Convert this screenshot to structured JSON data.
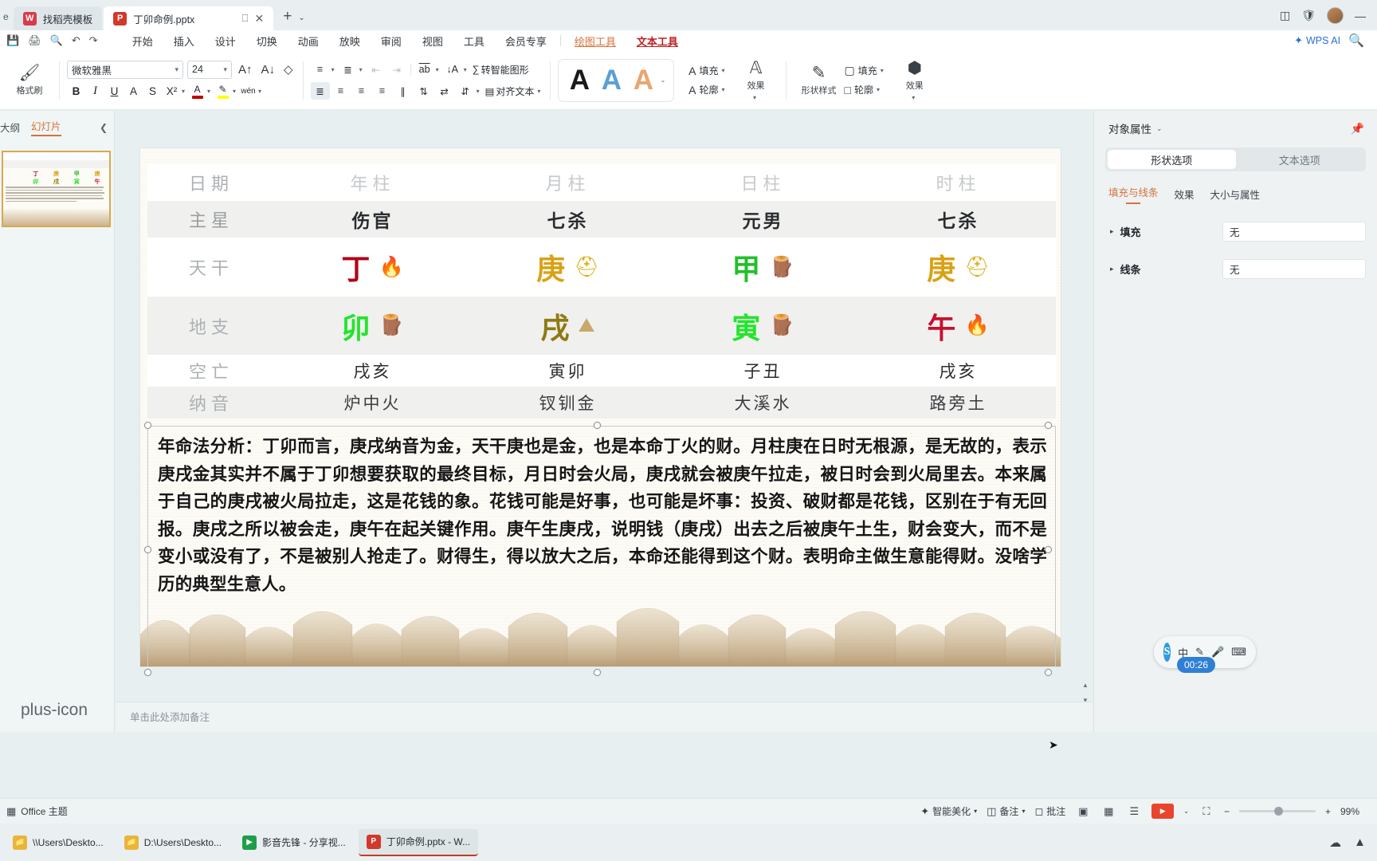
{
  "window": {
    "tab_edge_label": "e",
    "tabs": [
      {
        "label": "找稻壳模板",
        "icon": "wps-dove-icon",
        "active": false
      },
      {
        "label": "丁卯命例.pptx",
        "icon": "powerpoint-icon",
        "active": true
      }
    ],
    "new_tab_label": "+",
    "new_tab_caret": "⌄",
    "right_icons": [
      "layout-panel-icon",
      "shield-icon",
      "avatar"
    ]
  },
  "menu": {
    "quick_access": [
      "save-icon",
      "print-icon",
      "find-icon",
      "undo-icon",
      "redo-icon"
    ],
    "items": [
      {
        "label": "开始",
        "style": "normal"
      },
      {
        "label": "插入",
        "style": "normal"
      },
      {
        "label": "设计",
        "style": "normal"
      },
      {
        "label": "切换",
        "style": "normal"
      },
      {
        "label": "动画",
        "style": "normal"
      },
      {
        "label": "放映",
        "style": "normal"
      },
      {
        "label": "审阅",
        "style": "normal"
      },
      {
        "label": "视图",
        "style": "normal"
      },
      {
        "label": "工具",
        "style": "normal"
      },
      {
        "label": "会员专享",
        "style": "normal"
      },
      {
        "label": "绘图工具",
        "style": "orange"
      },
      {
        "label": "文本工具",
        "style": "red"
      }
    ],
    "ai_label": "WPS AI",
    "search_icon": "search-icon"
  },
  "ribbon": {
    "format_brush": {
      "label": "格式刷",
      "icon": "format-brush-icon"
    },
    "font_name": "微软雅黑",
    "font_size": "24",
    "grow_font_icon": "increase-font-size-icon",
    "shrink_font_icon": "decrease-font-size-icon",
    "clear_format_icon": "clear-formatting-icon",
    "bold": "B",
    "italic": "I",
    "underline": "U",
    "strike_a": "A",
    "strike": "S",
    "superscript": "X²",
    "font_color_icon": "font-color-icon",
    "highlight_icon": "text-highlight-icon",
    "pinyin_icon": "pinyin-guide-icon",
    "bullets_icon": "bulleted-list-icon",
    "numbering_icon": "numbered-list-icon",
    "decrease_indent_icon": "decrease-indent-icon",
    "increase_indent_icon": "increase-indent-icon",
    "text_direction_icon": "text-direction-icon",
    "sort_icon": "sort-icon",
    "smartart_label": "转智能图形",
    "align_left_icon": "align-left-icon",
    "align_center_icon": "align-center-icon",
    "align_right_icon": "align-right-icon",
    "align_justify_icon": "align-justify-icon",
    "distribute_icon": "distribute-text-icon",
    "line_spacing_icon": "line-spacing-icon",
    "paragraph_spacing_icon": "paragraph-spacing-icon",
    "align_text_label": "对齐文本",
    "wordart": {
      "samples": [
        "A",
        "A",
        "A"
      ],
      "more_caret": "⌄"
    },
    "text_fill_label": "填充",
    "text_outline_label": "轮廓",
    "text_effects_label": "效果",
    "shape_style_label": "形状样式",
    "shape_fill_label": "填充",
    "shape_outline_label": "轮廓",
    "shape_effects_label": "效果",
    "colors": {
      "font_color": "#c00000",
      "highlight": "#ffff00",
      "text_fill": "#c00000",
      "shape_fill": "#c88a4a"
    }
  },
  "left_panel": {
    "tabs": [
      {
        "label": "大纲",
        "active": false
      },
      {
        "label": "幻灯片",
        "active": true
      }
    ],
    "collapse_icon": "chevron-left-icon",
    "add_slide_icon": "plus-icon",
    "thumbnail_index": "1"
  },
  "slide": {
    "table": {
      "columns": [
        "日期",
        "年柱",
        "月柱",
        "日柱",
        "时柱"
      ],
      "rows": [
        {
          "label": "主星",
          "type": "text",
          "values": [
            "伤官",
            "七杀",
            "元男",
            "七杀"
          ]
        },
        {
          "label": "天干",
          "type": "stem",
          "values": [
            {
              "char": "丁",
              "color": "#b00015",
              "element": "fire-icon",
              "glyph": "🔥"
            },
            {
              "char": "庚",
              "color": "#d9a216",
              "element": "metal-icon",
              "glyph": "⛰"
            },
            {
              "char": "甲",
              "color": "#22c02a",
              "element": "earth-icon",
              "glyph": "🪵"
            },
            {
              "char": "庚",
              "color": "#d9a216",
              "element": "metal-icon",
              "glyph": "⛰"
            }
          ]
        },
        {
          "label": "地支",
          "type": "branch",
          "values": [
            {
              "char": "卯",
              "color": "#22e52a",
              "element": "wood-icon",
              "glyph": "🪵"
            },
            {
              "char": "戌",
              "color": "#8f7a12",
              "element": "earth-icon",
              "glyph": "⛰"
            },
            {
              "char": "寅",
              "color": "#22e52a",
              "element": "wood-icon",
              "glyph": "🪵"
            },
            {
              "char": "午",
              "color": "#c8102e",
              "element": "fire-icon",
              "glyph": "🔥"
            }
          ]
        },
        {
          "label": "空亡",
          "type": "text",
          "values": [
            "戌亥",
            "寅卯",
            "子丑",
            "戌亥"
          ]
        },
        {
          "label": "纳音",
          "type": "text",
          "values": [
            "炉中火",
            "钗钏金",
            "大溪水",
            "路旁土"
          ]
        }
      ]
    },
    "body_text": "年命法分析：丁卯而言，庚戌纳音为金，天干庚也是金，也是本命丁火的财。月柱庚在日时无根源，是无故的，表示庚戌金其实并不属于丁卯想要获取的最终目标，月日时会火局，庚戌就会被庚午拉走，被日时会到火局里去。本来属于自己的庚戌被火局拉走，这是花钱的象。花钱可能是好事，也可能是坏事：投资、破财都是花钱，区别在于有无回报。庚戌之所以被会走，庚午在起关键作用。庚午生庚戌，说明钱（庚戌）出去之后被庚午土生，财会变大，而不是变小或没有了，不是被别人抢走了。财得生，得以放大之后，本命还能得到这个财。表明命主做生意能得财。没啥学历的典型生意人。"
  },
  "notes": {
    "placeholder": "单击此处添加备注"
  },
  "right_panel": {
    "title": "对象属性",
    "title_caret": "⌄",
    "pin_icon": "pin-icon",
    "segments": [
      {
        "label": "形状选项",
        "active": true
      },
      {
        "label": "文本选项",
        "active": false
      }
    ],
    "subtabs": [
      {
        "label": "填充与线条",
        "active": true
      },
      {
        "label": "效果",
        "active": false
      },
      {
        "label": "大小与属性",
        "active": false
      }
    ],
    "properties": [
      {
        "label": "填充",
        "value": "无"
      },
      {
        "label": "线条",
        "value": "无"
      }
    ]
  },
  "status_bar": {
    "theme_label": "Office 主题",
    "theme_icon": "grid-icon",
    "beautify_label": "智能美化",
    "beautify_icon": "sparkle-icon",
    "notes_label": "备注",
    "notes_icon": "notes-icon",
    "comment_label": "批注",
    "comment_icon": "comment-icon",
    "view_normal_icon": "normal-view-icon",
    "view_sorter_icon": "slide-sorter-icon",
    "view_reading_icon": "reading-view-icon",
    "play_icon": "play-icon",
    "play_caret": "⌄",
    "fit_icon": "fit-slide-icon",
    "zoom_level": "99%",
    "zoom_out": "−",
    "zoom_in": "+"
  },
  "taskbar": {
    "items": [
      {
        "label": "\\\\Users\\Deskto...",
        "icon": "folder-icon",
        "color": "#e8b53c",
        "active": false
      },
      {
        "label": "D:\\Users\\Deskto...",
        "icon": "folder-icon",
        "color": "#e8b53c",
        "active": false
      },
      {
        "label": "影音先锋 - 分享视...",
        "icon": "player-icon",
        "color": "#1f9e4a",
        "active": false
      },
      {
        "label": "丁卯命例.pptx - W...",
        "icon": "powerpoint-icon",
        "color": "#d0392b",
        "active": true
      }
    ],
    "right_icons": [
      "wps-cloud-icon",
      "tray-up-icon"
    ]
  },
  "ime": {
    "lang": "中",
    "pen_icon": "pen-icon",
    "mic_icon": "mic-icon",
    "keyboard_icon": "keyboard-icon",
    "brand": "S",
    "timer": "00:26"
  }
}
